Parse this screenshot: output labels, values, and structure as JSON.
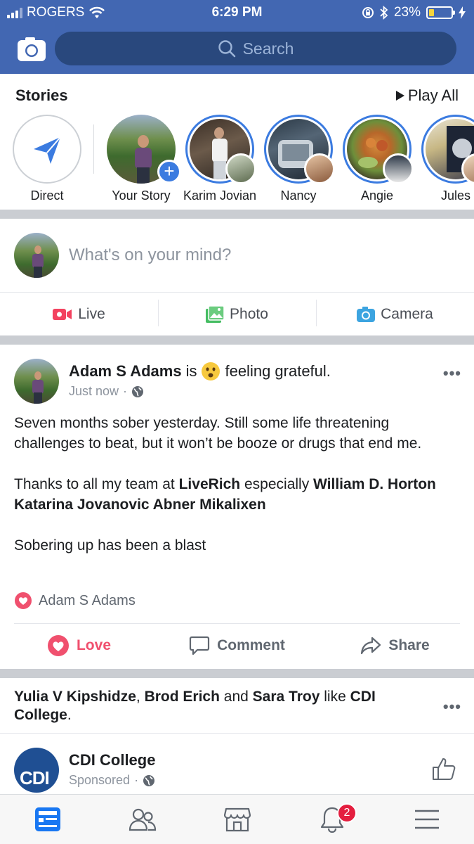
{
  "status_bar": {
    "carrier": "ROGERS",
    "time": "6:29 PM",
    "battery_percent": "23%",
    "battery_level": 0.23
  },
  "header": {
    "search_placeholder": "Search"
  },
  "stories": {
    "title": "Stories",
    "play_all": "Play All",
    "items": [
      {
        "label": "Direct"
      },
      {
        "label": "Your Story"
      },
      {
        "label": "Karim Jovian"
      },
      {
        "label": "Nancy"
      },
      {
        "label": "Angie"
      },
      {
        "label": "Jules"
      }
    ]
  },
  "composer": {
    "placeholder": "What's on your mind?",
    "actions": [
      {
        "label": "Live"
      },
      {
        "label": "Photo"
      },
      {
        "label": "Camera"
      }
    ]
  },
  "post": {
    "author": "Adam S Adams",
    "is_word": "is",
    "feeling": "feeling grateful.",
    "time": "Just now",
    "paragraph1": "Seven months sober yesterday. Still some life threatening challenges to beat, but it won’t be booze or drugs that end me.",
    "thanks_prefix": "Thanks to all my team at",
    "thanks_company": "LiveRich",
    "thanks_mid": "especially",
    "thanks_names": "William D. Horton Katarina Jovanovic Abner Mikalixen",
    "paragraph3": "Sobering up has been a blast",
    "reactor": "Adam S Adams",
    "buttons": {
      "love": "Love",
      "comment": "Comment",
      "share": "Share"
    }
  },
  "ad": {
    "name1": "Yulia V Kipshidze",
    "sep1": ",",
    "name2": "Brod Erich",
    "and_word": "and",
    "name3": "Sara Troy",
    "like_word": "like",
    "page": "CDI College",
    "period": ".",
    "page_name": "CDI College",
    "sponsored": "Sponsored",
    "logo_text": "CDI"
  },
  "tabbar": {
    "notification_count": "2"
  },
  "colors": {
    "brand_blue": "#4267b2",
    "search_bg": "#29487d",
    "story_ring": "#3b7be0",
    "love_red": "#f0506e",
    "badge_red": "#e41e3f",
    "battery_yellow": "#f5d43c"
  }
}
